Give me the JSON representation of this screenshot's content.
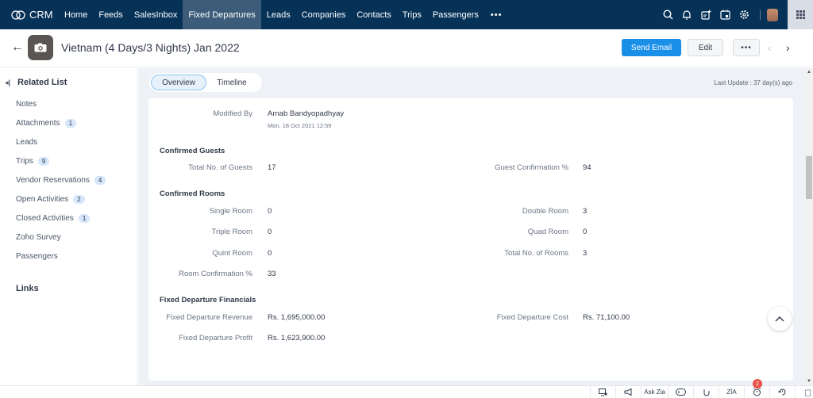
{
  "topnav": {
    "brand": "CRM",
    "items": [
      {
        "label": "Home",
        "active": false
      },
      {
        "label": "Feeds",
        "active": false
      },
      {
        "label": "SalesInbox",
        "active": false
      },
      {
        "label": "Fixed Departures",
        "active": true
      },
      {
        "label": "Leads",
        "active": false
      },
      {
        "label": "Companies",
        "active": false
      },
      {
        "label": "Contacts",
        "active": false
      },
      {
        "label": "Trips",
        "active": false
      },
      {
        "label": "Passengers",
        "active": false
      }
    ],
    "more_label": "•••",
    "right_icons": [
      "search-icon",
      "bell-icon",
      "add-note-icon",
      "calendar-icon",
      "gear-icon",
      "avatar",
      "apps-grid-icon"
    ]
  },
  "header": {
    "title": "Vietnam (4 Days/3 Nights) Jan 2022",
    "send_email": "Send Email",
    "edit": "Edit",
    "more": "•••"
  },
  "sidebar": {
    "related_list_title": "Related List",
    "items": [
      {
        "label": "Notes",
        "count": null
      },
      {
        "label": "Attachments",
        "count": "1"
      },
      {
        "label": "Leads",
        "count": null
      },
      {
        "label": "Trips",
        "count": "9"
      },
      {
        "label": "Vendor Reservations",
        "count": "4"
      },
      {
        "label": "Open Activities",
        "count": "2"
      },
      {
        "label": "Closed Activities",
        "count": "1"
      },
      {
        "label": "Zoho Survey",
        "count": null
      },
      {
        "label": "Passengers",
        "count": null
      }
    ],
    "links_title": "Links"
  },
  "tabs": {
    "overview": "Overview",
    "timeline": "Timeline",
    "last_update": "Last Update : 37 day(s) ago"
  },
  "record": {
    "modified_by_label": "Modified By",
    "modified_by_value": "Arnab Bandyopadhyay",
    "modified_time": "Mon, 18 Oct 2021 12:59",
    "confirmed_guests": {
      "title": "Confirmed Guests",
      "total_guests_label": "Total No. of Guests",
      "total_guests": "17",
      "guest_confirmation_label": "Guest Confirmation %",
      "guest_confirmation": "94"
    },
    "confirmed_rooms": {
      "title": "Confirmed Rooms",
      "single_label": "Single Room",
      "single": "0",
      "double_label": "Double Room",
      "double": "3",
      "triple_label": "Triple Room",
      "triple": "0",
      "quad_label": "Quad Room",
      "quad": "0",
      "quint_label": "Quint Room",
      "quint": "0",
      "total_rooms_label": "Total No. of Rooms",
      "total_rooms": "3",
      "room_confirmation_label": "Room Confirmation %",
      "room_confirmation": "33"
    },
    "financials": {
      "title": "Fixed Departure Financials",
      "revenue_label": "Fixed Departure Revenue",
      "revenue": "Rs. 1,695,000.00",
      "cost_label": "Fixed Departure Cost",
      "cost": "Rs. 71,100.00",
      "profit_label": "Fixed Departure Profit",
      "profit": "Rs. 1,623,900.00"
    }
  },
  "footer": {
    "ask_zia": "Ask Zia",
    "reminder_count": "2"
  },
  "colors": {
    "nav_bg": "#073258",
    "nav_active": "#3c5c79",
    "primary": "#1a8fe8",
    "badge_bg": "#d6e6fb",
    "notif": "#e9534a"
  }
}
